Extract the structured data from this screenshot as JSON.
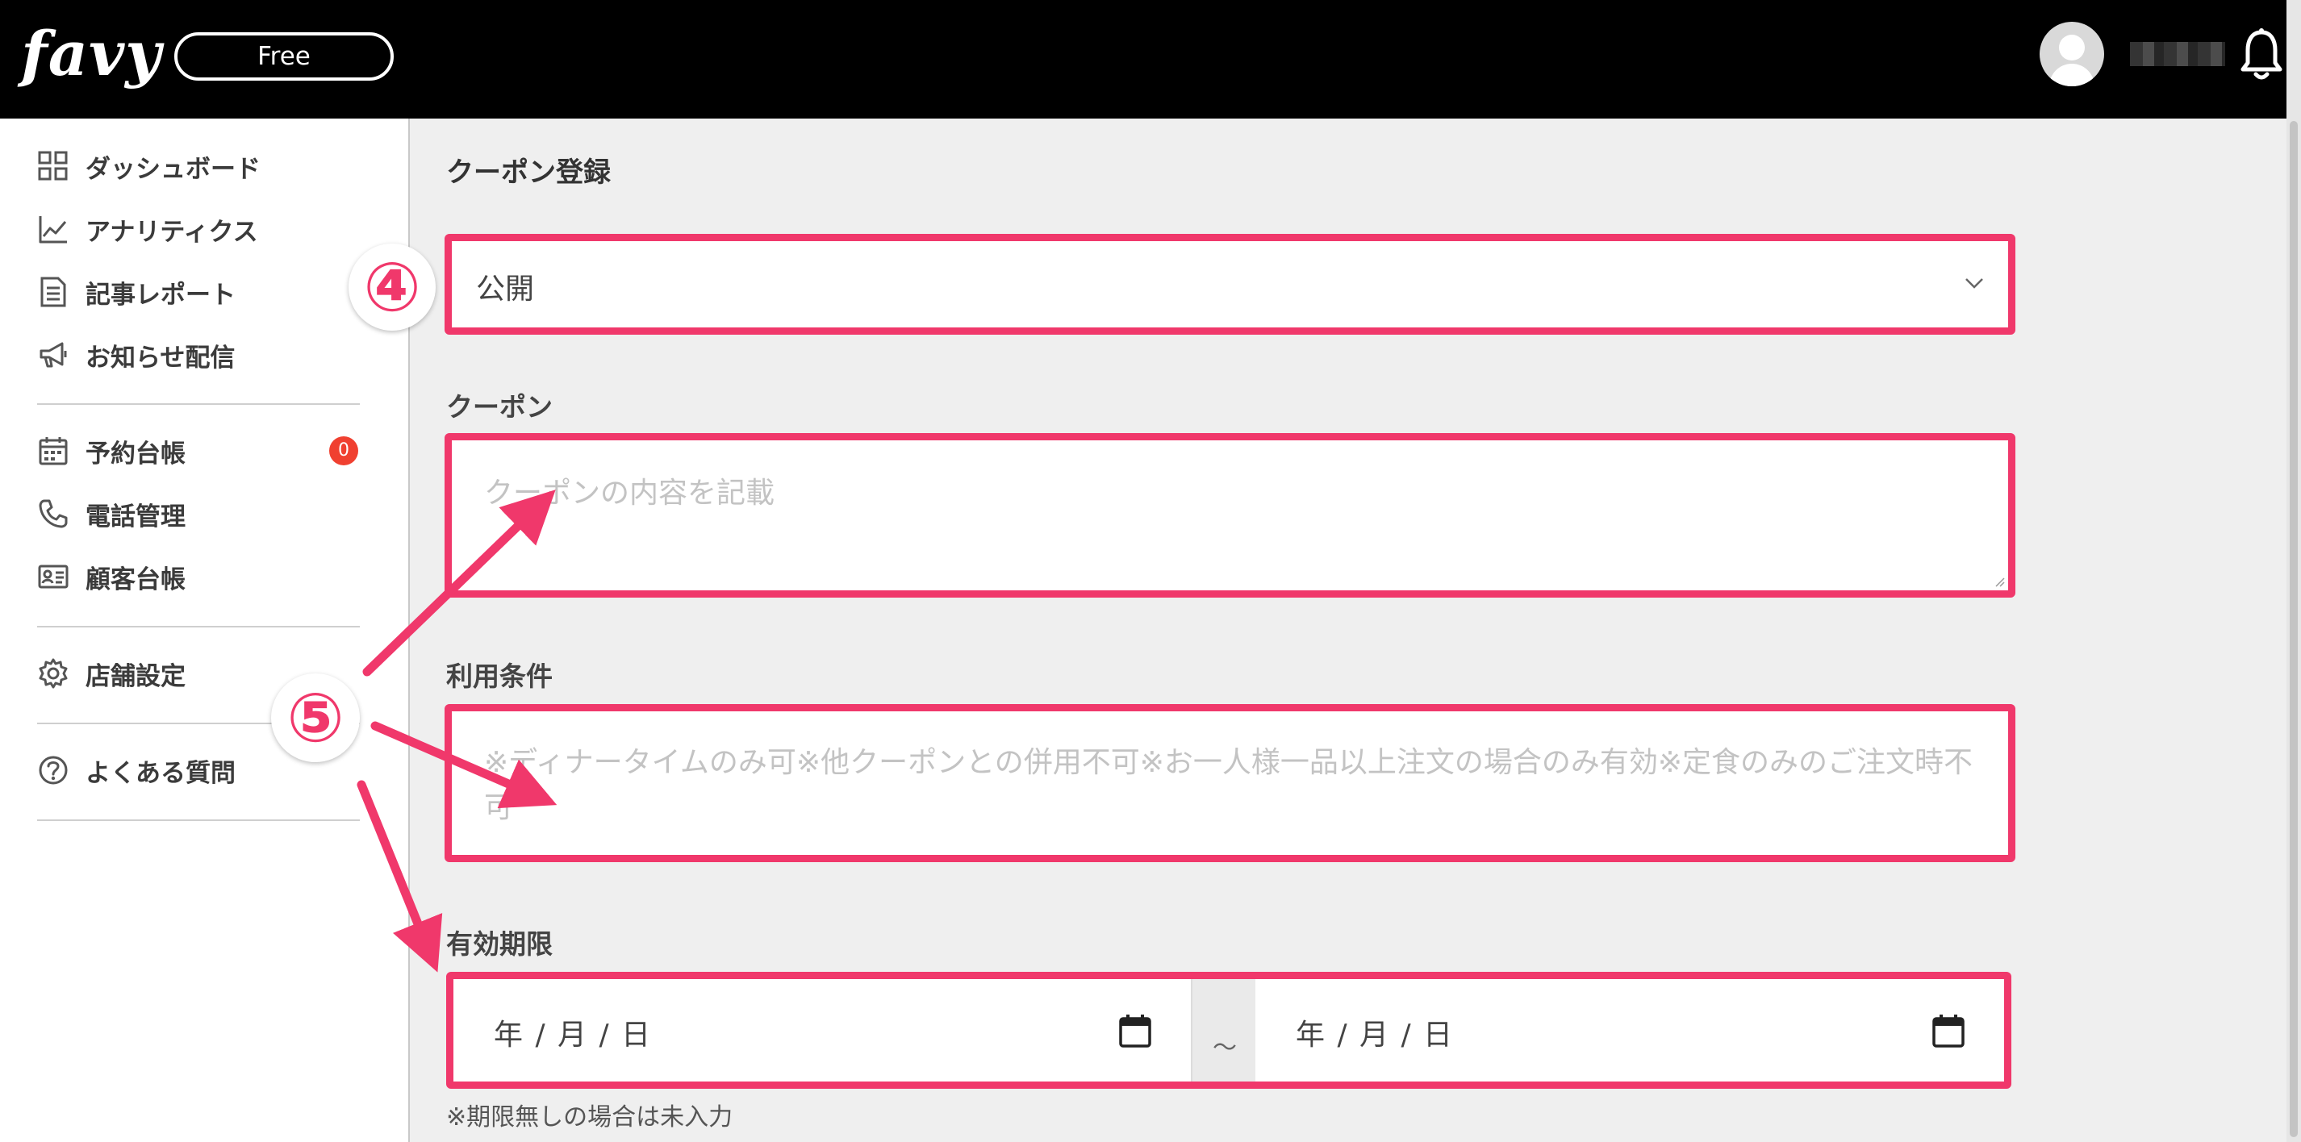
{
  "header": {
    "logo_text": "favy",
    "plan_label": "Free"
  },
  "sidebar": {
    "items": [
      {
        "label": "ダッシュボード",
        "icon": "grid-icon"
      },
      {
        "label": "アナリティクス",
        "icon": "chart-line-icon"
      },
      {
        "label": "記事レポート",
        "icon": "document-icon"
      },
      {
        "label": "お知らせ配信",
        "icon": "megaphone-icon"
      },
      {
        "label": "予約台帳",
        "icon": "calendar-icon",
        "badge": "0"
      },
      {
        "label": "電話管理",
        "icon": "phone-icon"
      },
      {
        "label": "顧客台帳",
        "icon": "id-card-icon"
      },
      {
        "label": "店舗設定",
        "icon": "gear-icon"
      },
      {
        "label": "よくある質問",
        "icon": "question-circle-icon"
      }
    ]
  },
  "main": {
    "title": "クーポン登録",
    "status_select": {
      "value": "公開"
    },
    "coupon": {
      "label": "クーポン",
      "placeholder": "クーポンの内容を記載"
    },
    "conditions": {
      "label": "利用条件",
      "placeholder": "※ディナータイムのみ可※他クーポンとの併用不可※お一人様一品以上注文の場合のみ有効※定食のみのご注文時不可"
    },
    "validity": {
      "label": "有効期限",
      "start_placeholder": "年 / 月 / 日",
      "end_placeholder": "年 / 月 / 日",
      "separator": "～",
      "note": "※期限無しの場合は未入力"
    }
  },
  "annotations": {
    "step4": "④",
    "step5": "⑤"
  },
  "colors": {
    "highlight": "#f0386b",
    "header_bg": "#000000",
    "badge": "#f04030"
  }
}
